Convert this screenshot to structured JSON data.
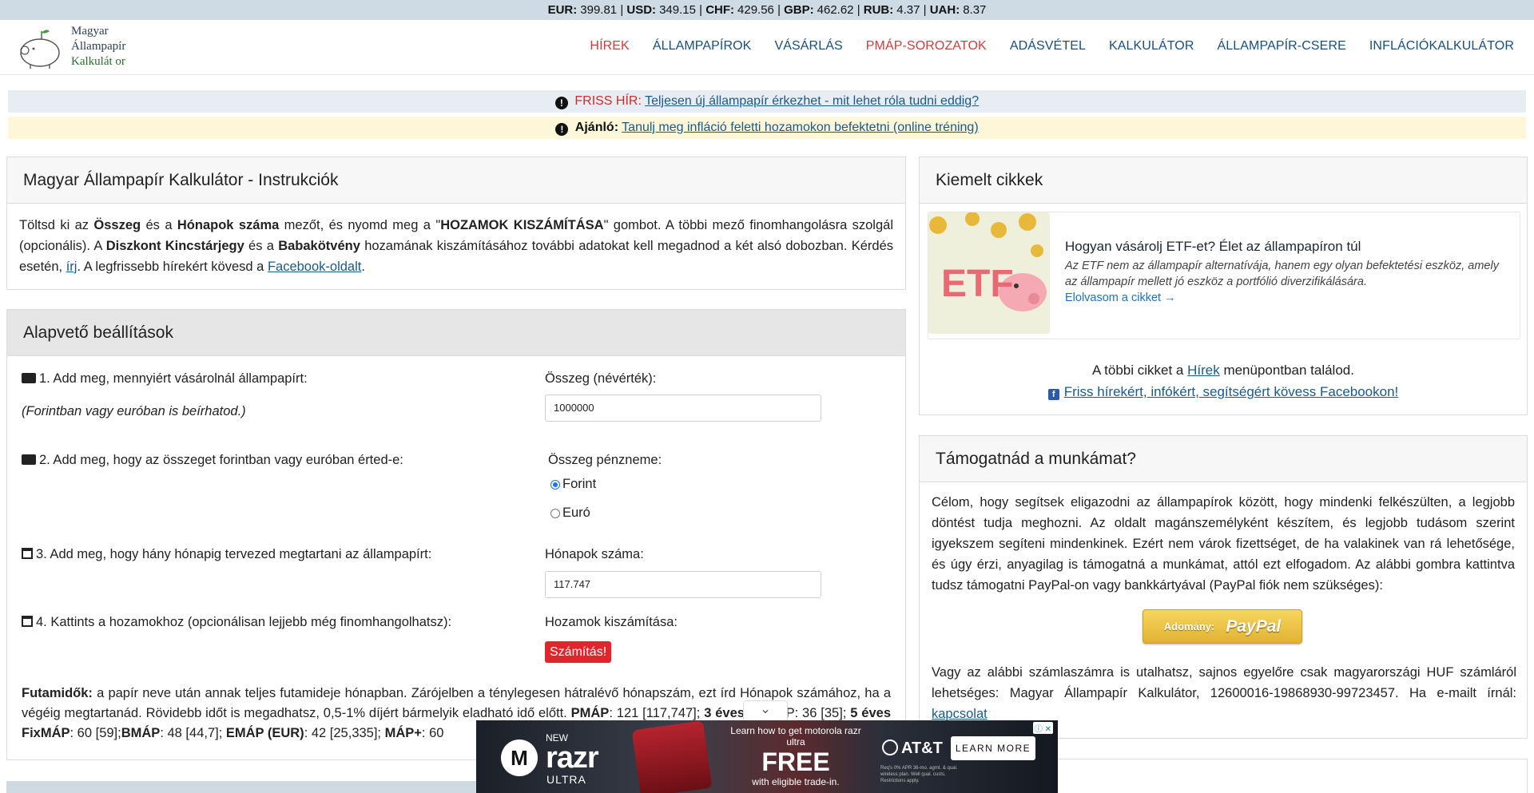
{
  "ticker": {
    "rates": [
      {
        "code": "EUR:",
        "value": "399.81"
      },
      {
        "code": "USD:",
        "value": "349.15"
      },
      {
        "code": "CHF:",
        "value": "429.56"
      },
      {
        "code": "GBP:",
        "value": "462.62"
      },
      {
        "code": "RUB:",
        "value": "4.37"
      },
      {
        "code": "UAH:",
        "value": "8.37"
      }
    ],
    "separator": " | "
  },
  "logo": {
    "line1": "Magyar",
    "line2": "Állampapír",
    "line3": "Kalkulát or"
  },
  "nav": [
    {
      "label": "HÍREK",
      "color": "#cc3f3f"
    },
    {
      "label": "ÁLLAMPAPÍROK",
      "color": "#1a4f7a"
    },
    {
      "label": "VÁSÁRLÁS",
      "color": "#1a4f7a"
    },
    {
      "label": "PMÁP-SOROZATOK",
      "color": "#cc3f3f"
    },
    {
      "label": "ADÁSVÉTEL",
      "color": "#1a4f7a"
    },
    {
      "label": "KALKULÁTOR",
      "color": "#1a4f7a"
    },
    {
      "label": "ÁLLAMPAPÍR-CSERE",
      "color": "#1a4f7a"
    },
    {
      "label": "INFLÁCIÓKALKULÁTOR",
      "color": "#1a4f7a"
    }
  ],
  "banners": {
    "news": {
      "prefix": "FRISS HÍR:",
      "link": "Teljesen új állampapír érkezhet - mit lehet róla tudni eddig?"
    },
    "tip": {
      "prefix": "Ajánló:",
      "link": "Tanulj meg infláció feletti hozamokon befektetni (online tréning)"
    }
  },
  "instructions": {
    "title": "Magyar Állampapír Kalkulátor - Instrukciók",
    "t1": "Töltsd ki az ",
    "b1": "Összeg",
    "t2": " és a ",
    "b2": "Hónapok száma",
    "t3": " mezőt, és nyomd meg a \"",
    "b3": "HOZAMOK KISZÁMÍTÁSA",
    "t4": "\" gombot. A többi mező finomhangolásra szolgál (opcionális). A ",
    "b4": "Diszkont Kincstárjegy",
    "t5": " és a ",
    "b5": "Babakötvény",
    "t6": " hozamának kiszámításához további adatokat kell megadnod a két alsó dobozban. Kérdés esetén, ",
    "link1": "írj",
    "t7": ". A legfrissebb hírekért kövesd a ",
    "link2": "Facebook-oldalt",
    "t8": "."
  },
  "settings": {
    "title": "Alapvető beállítások",
    "q1": "1. Add meg, mennyiért vásárolnál állampapírt:",
    "q1_hint": "(Forintban vagy euróban is beírhatod.)",
    "amount_label": "Összeg (névérték):",
    "amount_value": "1000000",
    "q2": "2. Add meg, hogy az összeget forintban vagy euróban érted-e:",
    "currency_label": "Összeg pénzneme:",
    "currency_options": [
      "Forint",
      "Euró"
    ],
    "currency_selected": "Forint",
    "q3": "3. Add meg, hogy hány hónapig tervezed megtartani az állampapírt:",
    "months_label": "Hónapok száma:",
    "months_value": "117.747",
    "q4": "4. Kattints a hozamokhoz (opcionálisan lejjebb még finomhangolhatsz):",
    "calc_label": "Hozamok kiszámítása:",
    "calc_button": "Számítás!",
    "futam": {
      "b1": "Futamidők:",
      "t1": " a papír neve után annak teljes futamideje hónapban. Zárójelben a ténylegesen hátralévő hónapszám, ezt írd Hónapok számához, ha a végéig megtartanád. Rövidebb időt is megadhatsz, 0,5-1% díjért bármelyik eladható idő előtt. ",
      "b2": "PMÁP",
      "t2": ": 121 [117,747]; ",
      "b3": "3 éves",
      "t3": " FixMÁP: 36 [35]; ",
      "b4": "5 éves FixMÁP",
      "t4": ": 60 [59];",
      "b5": "BMÁP",
      "t5": ": 48 [44,7]; ",
      "b6": "EMÁP (EUR)",
      "t6": ": 42 [25,335]; ",
      "b7": "MÁP+",
      "t7": ": 60"
    }
  },
  "featured": {
    "title": "Kiemelt cikkek",
    "thumb_text": "ETF",
    "article_title": "Hogyan vásárolj ETF-et? Élet az állampapíron túl",
    "article_desc": "Az ETF nem az állampapír alternatívája, hanem egy olyan befektetési eszköz, amely az állampapír mellett jó eszköz a portfólió diverzifikálására.",
    "article_link": "Elolvasom a cikket →",
    "more_pre": "A többi cikket a ",
    "more_link": "Hírek",
    "more_post": " menüpontban találod.",
    "fb_link": "Friss hírekért, infókért, segítségért kövess Facebookon!"
  },
  "support": {
    "title": "Támogatnád a munkámat?",
    "text": "Célom, hogy segítsek eligazodni az állampapírok között, hogy mindenki felkészülten, a legjobb döntést tudja meghozni. Az oldalt magánszemélyként készítem, és legjobb tudásom szerint igyekszem segíteni mindenkinek. Ezért nem várok fizettséget, de ha valakinek van rá lehetősége, és úgy érzi, anyagilag is támogatná a munkámat, attól ezt elfogadom. Az alábbi gombra kattintva tudsz támogatni PayPal-on vagy bankkártyával (PayPal fiók nem szükséges):",
    "paypal_donate": "Adomány:",
    "paypal_brand": "PayPal",
    "text2": "Vagy az alábbi számlaszámra is utalhatsz, sajnos egyelőre csak magyarországi HUF számláról lehetséges: Magyar Állampapír Kalkulátor, 12600016-19868930-99723457. Ha e-mailt írnál: ",
    "contact_link": "kapcsolat"
  },
  "ad": {
    "new": "NEW",
    "brand": "razr",
    "model": "ULTRA",
    "learn": "Learn how to get motorola razr ultra",
    "free": "FREE",
    "trade": "with eligible trade-in.",
    "carrier": "AT&T",
    "cta": "LEARN MORE",
    "fine": "Req's 0% APR 36-mo. agmt. & qual. wireless plan. Well qual. custs. Restrictions apply."
  }
}
